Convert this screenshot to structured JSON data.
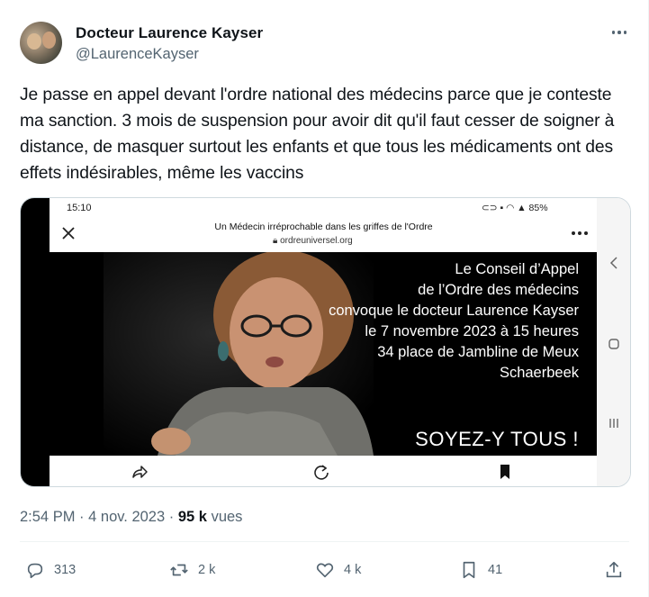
{
  "author": {
    "name": "Docteur Laurence Kayser",
    "handle": "@LaurenceKayser"
  },
  "tweet": {
    "text": "Je passe en appel devant l'ordre national des médecins parce que je conteste ma sanction. 3 mois de suspension pour avoir dit qu'il faut cesser de soigner à distance, de masquer surtout les enfants et que tous les médicaments ont des effets indésirables, même les vaccins"
  },
  "media": {
    "status_time": "15:10",
    "status_right": "85%",
    "page_title": "Un Médecin irréprochable dans les griffes de l'Ordre",
    "page_url": "ordreuniversel.org",
    "overlay_lines": [
      "Le Conseil d’Appel",
      "de l’Ordre des médecins",
      "convoque le docteur Laurence Kayser",
      "le 7 novembre 2023 à 15 heures",
      "34 place de Jambline de Meux",
      "Schaerbeek"
    ],
    "overlay_cta": "SOYEZ-Y TOUS !"
  },
  "meta": {
    "time": "2:54 PM",
    "sep": "·",
    "date": "4 nov. 2023",
    "sep2": "·",
    "views_count": "95 k",
    "views_label": "vues"
  },
  "actions": {
    "replies": "313",
    "reposts": "2 k",
    "likes": "4 k",
    "bookmarks": "41"
  },
  "colors": {
    "secondary_text": "#536471",
    "primary_text": "#0f1419",
    "border": "#cfd9de"
  }
}
